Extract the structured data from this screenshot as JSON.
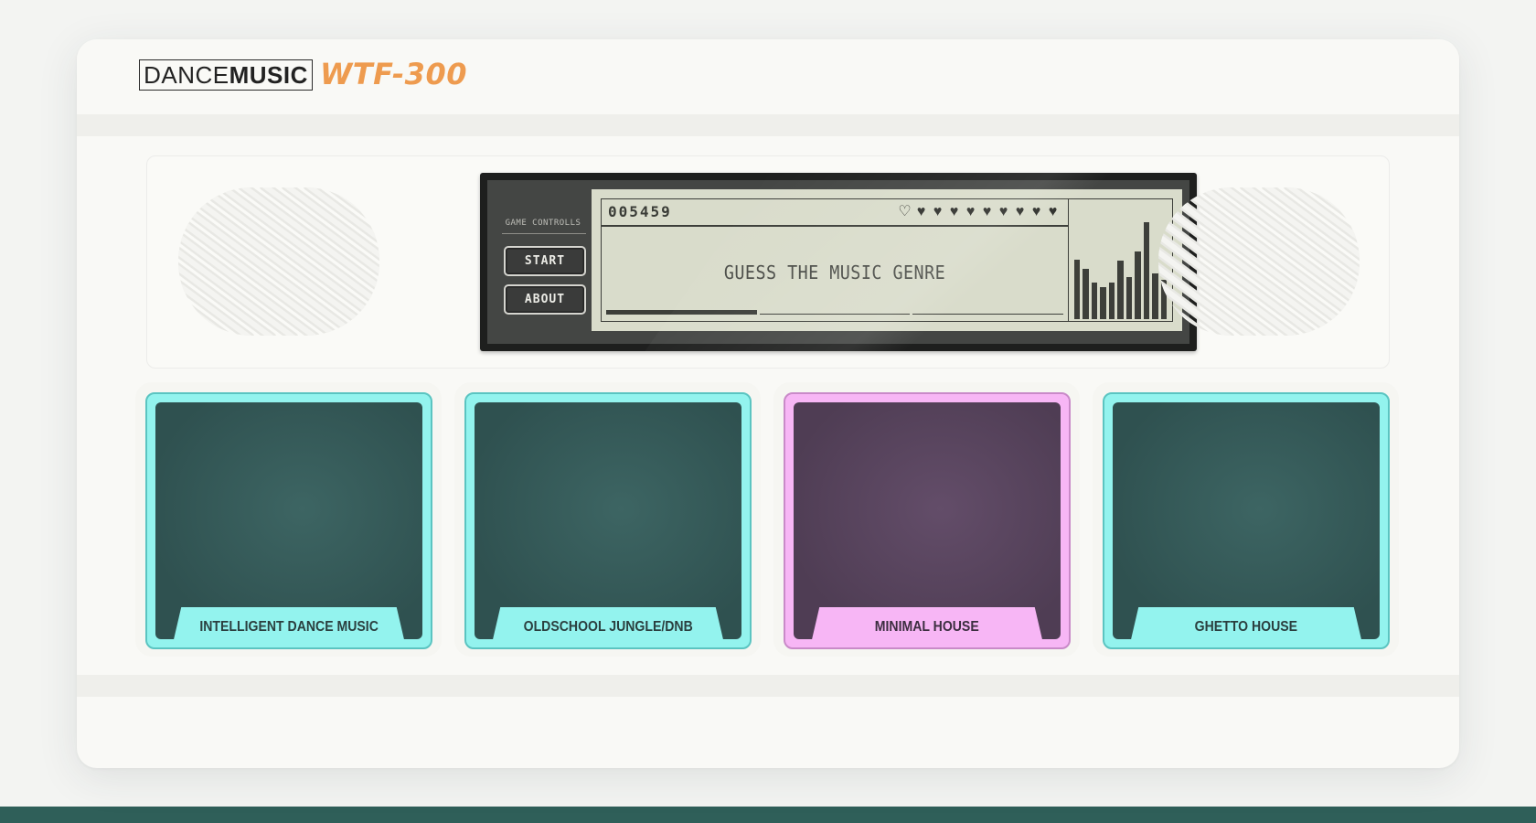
{
  "brand": {
    "part1": "DANCE",
    "part2": "MUSIC",
    "model": "WTF-300"
  },
  "controls": {
    "label": "GAME CONTROLLS",
    "start_label": "START",
    "about_label": "ABOUT"
  },
  "display": {
    "score": "005459",
    "lives_total": 10,
    "lives_full": 9,
    "heart_full": "♥",
    "heart_empty": "♡",
    "message": "GUESS THE MUSIC GENRE",
    "progress_segments": 3,
    "progress_filled": 1,
    "equalizer_levels": [
      0.54,
      0.46,
      0.33,
      0.29,
      0.33,
      0.53,
      0.38,
      0.62,
      0.88,
      0.42,
      0.36
    ]
  },
  "pads": [
    {
      "label": "INTELLIGENT DANCE MUSIC",
      "color": "teal"
    },
    {
      "label": "OLDSCHOOL JUNGLE/DNB",
      "color": "teal"
    },
    {
      "label": "MINIMAL HOUSE",
      "color": "pink"
    },
    {
      "label": "GHETTO HOUSE",
      "color": "teal"
    }
  ],
  "colors": {
    "teal_pad": "#93f3ee",
    "pink_pad": "#f7b6f5",
    "model_accent": "#ee9b4f",
    "lcd_bg": "#d9dccb"
  }
}
